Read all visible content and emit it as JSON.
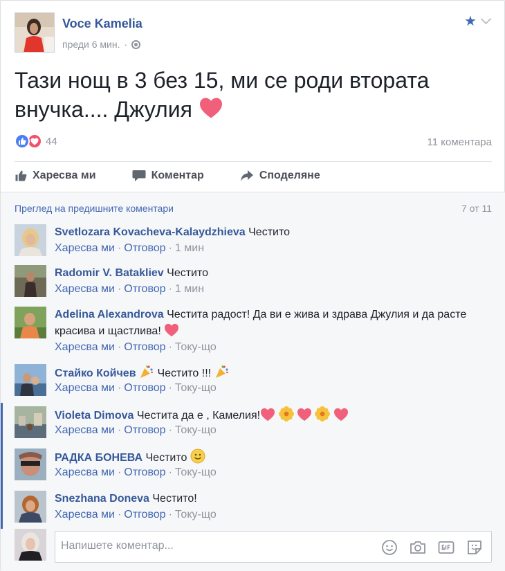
{
  "post": {
    "author": "Voce Kamelia",
    "time": "преди 6 мин.",
    "text": "Тази нощ в 3 без 15, ми се роди втората внучка.... Джулия",
    "reaction_count": "44",
    "comment_count": "11 коментара",
    "icons": {
      "star": "star-icon",
      "chevron": "chevron-down-icon",
      "globe": "globe-icon"
    }
  },
  "actions": {
    "like": "Харесва ми",
    "comment": "Коментар",
    "share": "Споделяне"
  },
  "comments_header": {
    "view_previous": "Преглед на предишните коментари",
    "pager": "7 от 11"
  },
  "comments": [
    {
      "name": "Svetlozara Kovacheva-Kalaydzhieva",
      "text": "Честито",
      "like": "Харесва ми",
      "reply": "Отговор",
      "time": "1 мин"
    },
    {
      "name": "Radomir V. Batakliev",
      "text": "Честито",
      "like": "Харесва ми",
      "reply": "Отговор",
      "time": "1 мин"
    },
    {
      "name": "Adelina Alexandrova",
      "text": "Честита радост! Да ви е жива и здрава Джулия и да расте красива и щастлива!",
      "like": "Харесва ми",
      "reply": "Отговор",
      "time": "Току-що"
    },
    {
      "name": "Стайко Койчев",
      "text": "Честито !!!",
      "like": "Харесва ми",
      "reply": "Отговор",
      "time": "Току-що"
    },
    {
      "name": "Violeta Dimova",
      "text": "Честита да е , Камелия!",
      "like": "Харесва ми",
      "reply": "Отговор",
      "time": "Току-що"
    },
    {
      "name": "РАДКА БОНЕВА",
      "text": "Честито",
      "like": "Харесва ми",
      "reply": "Отговор",
      "time": "Току-що"
    },
    {
      "name": "Snezhana Doneva",
      "text": "Честито!",
      "like": "Харесва ми",
      "reply": "Отговор",
      "time": "Току-що"
    }
  ],
  "composer": {
    "placeholder": "Напишете коментар..."
  },
  "colors": {
    "link": "#4267b2",
    "name": "#365899",
    "muted": "#90949c",
    "heart": "#f25268",
    "like_blue": "#4a7ef4"
  }
}
